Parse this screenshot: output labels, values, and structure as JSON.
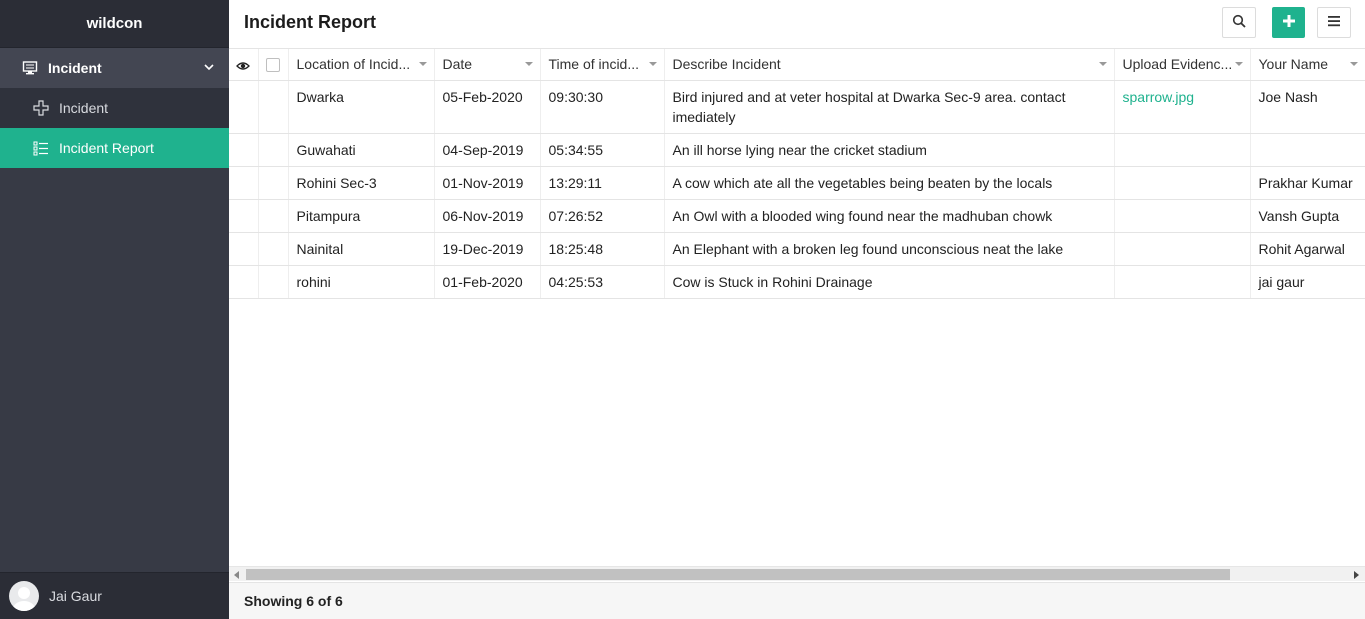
{
  "app": {
    "brand": "wildcon",
    "accent_color": "#1fb28e"
  },
  "sidebar": {
    "group": {
      "label": "Incident",
      "icon": "monitor-icon"
    },
    "items": [
      {
        "label": "Incident",
        "icon": "add-form-icon",
        "active": false
      },
      {
        "label": "Incident Report",
        "icon": "list-icon",
        "active": true
      }
    ],
    "user": {
      "name": "Jai Gaur"
    }
  },
  "header": {
    "title": "Incident Report",
    "buttons": [
      "search-icon",
      "plus-icon",
      "hamburger-menu-icon"
    ]
  },
  "table": {
    "columns": [
      "Location of Incid...",
      "Date",
      "Time of incid...",
      "Describe Incident",
      "Upload Evidenc...",
      "Your Name"
    ],
    "rows": [
      {
        "location": "Dwarka",
        "date": "05-Feb-2020",
        "time": "09:30:30",
        "description": "Bird injured and at veter hospital at Dwarka Sec-9 area. contact imediately",
        "evidence": "sparrow.jpg",
        "name": "Joe Nash"
      },
      {
        "location": "Guwahati",
        "date": "04-Sep-2019",
        "time": "05:34:55",
        "description": "An ill horse lying near the cricket stadium",
        "evidence": "",
        "name": ""
      },
      {
        "location": "Rohini Sec-3",
        "date": "01-Nov-2019",
        "time": "13:29:11",
        "description": "A cow which ate all the vegetables being beaten by the locals",
        "evidence": "",
        "name": "Prakhar Kumar"
      },
      {
        "location": "Pitampura",
        "date": "06-Nov-2019",
        "time": "07:26:52",
        "description": "An Owl with a blooded wing found near the madhuban chowk",
        "evidence": "",
        "name": "Vansh Gupta"
      },
      {
        "location": "Nainital",
        "date": "19-Dec-2019",
        "time": "18:25:48",
        "description": "An Elephant with a broken leg found unconscious neat the lake",
        "evidence": "",
        "name": "Rohit Agarwal"
      },
      {
        "location": "rohini",
        "date": "01-Feb-2020",
        "time": "04:25:53",
        "description": "Cow is Stuck in Rohini Drainage",
        "evidence": "",
        "name": "jai gaur"
      }
    ]
  },
  "footer": {
    "status": "Showing 6 of 6"
  }
}
